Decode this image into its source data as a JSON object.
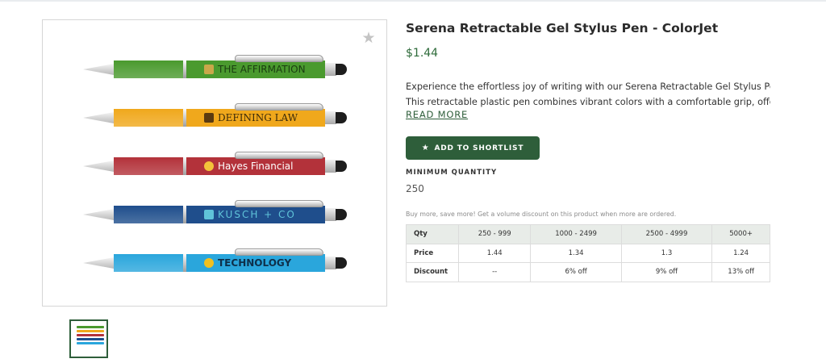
{
  "product": {
    "title": "Serena Retractable Gel Stylus Pen - ColorJet",
    "price": "$1.44",
    "description_lines": [
      "Experience the effortless joy of writing with our Serena Retractable Gel Stylus Pen.",
      "This retractable plastic pen combines vibrant colors with a comfortable grip, offerin..."
    ],
    "read_more": "READ MORE",
    "shortlist_label": "ADD TO SHORTLIST",
    "min_qty_label": "MINIMUM QUANTITY",
    "min_qty_value": "250",
    "volume_note": "Buy more, save more! Get a volume discount on this product when more are ordered."
  },
  "pens": [
    {
      "color": "#4a9a2e",
      "imprint": "THE AFFIRMATION",
      "imprint_color": "#1a3d10",
      "logo_color": "#c9a84a"
    },
    {
      "color": "#f0a81c",
      "imprint": "DEFINING LAW",
      "imprint_color": "#3a2a0a",
      "logo_color": "#5a3a10"
    },
    {
      "color": "#b3323a",
      "imprint": "Hayes Financial",
      "imprint_color": "#ffffff",
      "logo_color": "#f3c23a"
    },
    {
      "color": "#1f4e8c",
      "imprint": "KUSCH + CO",
      "imprint_color": "#5fc3d9",
      "logo_color": "#5fc3d9"
    },
    {
      "color": "#2aa6dc",
      "imprint": "TECHNOLOGY",
      "imprint_color": "#0e2f4a",
      "logo_color": "#f0c020"
    }
  ],
  "price_table": {
    "headers": [
      "Qty",
      "250 - 999",
      "1000 - 2499",
      "2500 - 4999",
      "5000+"
    ],
    "rows": [
      [
        "Price",
        "1.44",
        "1.34",
        "1.3",
        "1.24"
      ],
      [
        "Discount",
        "--",
        "6% off",
        "9% off",
        "13% off"
      ]
    ]
  },
  "icons": {
    "favorite": "star-icon",
    "shortlist": "star-icon"
  },
  "colors": {
    "brand_green": "#2e5e3a",
    "price_green": "#2e6b3a"
  }
}
